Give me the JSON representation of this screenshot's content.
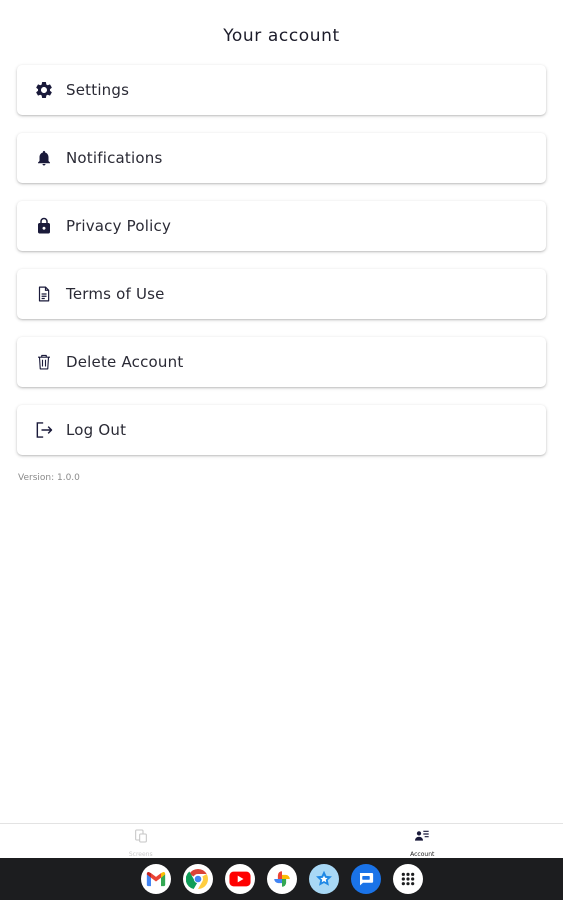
{
  "header": {
    "title": "Your account"
  },
  "menu": {
    "items": [
      {
        "label": "Settings",
        "icon": "gear-icon"
      },
      {
        "label": "Notifications",
        "icon": "bell-icon"
      },
      {
        "label": "Privacy Policy",
        "icon": "lock-icon"
      },
      {
        "label": "Terms of Use",
        "icon": "document-icon"
      },
      {
        "label": "Delete Account",
        "icon": "trash-icon"
      },
      {
        "label": "Log Out",
        "icon": "logout-icon"
      }
    ]
  },
  "footer": {
    "version": "Version: 1.0.0"
  },
  "bottom_nav": {
    "items": [
      {
        "label": "Screens",
        "icon": "screens-icon",
        "active": false
      },
      {
        "label": "Account",
        "icon": "account-icon",
        "active": true
      }
    ]
  },
  "taskbar": {
    "apps": [
      "gmail-icon",
      "chrome-icon",
      "youtube-icon",
      "photos-icon",
      "app-store-icon",
      "messages-icon",
      "app-launcher-icon"
    ]
  },
  "colors": {
    "icon_dark": "#1a1a3a",
    "background": "#ffffff",
    "taskbar": "#1c1d1f"
  }
}
